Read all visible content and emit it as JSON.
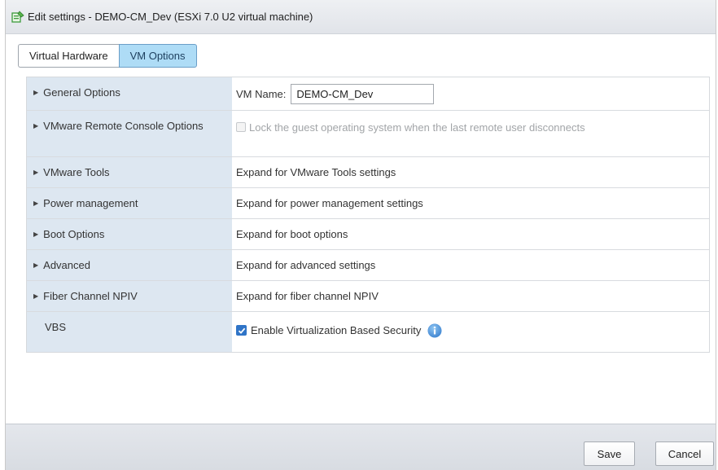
{
  "window": {
    "title": "Edit settings - DEMO-CM_Dev (ESXi 7.0 U2 virtual machine)",
    "icon": "edit-vm-icon"
  },
  "tabs": [
    {
      "label": "Virtual Hardware",
      "active": false
    },
    {
      "label": "VM Options",
      "active": true
    }
  ],
  "general": {
    "label": "General Options",
    "vm_name_label": "VM Name:",
    "vm_name_value": "DEMO-CM_Dev"
  },
  "remote_console": {
    "label": "VMware Remote Console Options",
    "checkbox_label": "Lock the guest operating system when the last remote user disconnects",
    "checked": false,
    "disabled": true
  },
  "rows": [
    {
      "label": "VMware Tools",
      "value": "Expand for VMware Tools settings"
    },
    {
      "label": "Power management",
      "value": "Expand for power management settings"
    },
    {
      "label": "Boot Options",
      "value": "Expand for boot options"
    },
    {
      "label": "Advanced",
      "value": "Expand for advanced settings"
    },
    {
      "label": "Fiber Channel NPIV",
      "value": "Expand for fiber channel NPIV"
    }
  ],
  "vbs": {
    "label": "VBS",
    "checkbox_label": "Enable Virtualization Based Security",
    "checked": true
  },
  "footer": {
    "save_label": "Save",
    "cancel_label": "Cancel"
  },
  "colors": {
    "active_tab": "#aedcf6",
    "label_column": "#dde7f1",
    "checkbox_checked": "#2f74c7",
    "info_icon": "#4a90d9"
  }
}
